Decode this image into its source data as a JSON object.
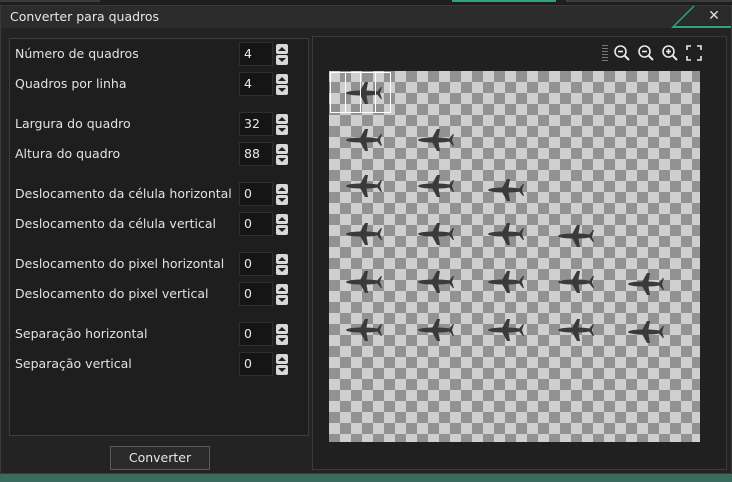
{
  "window": {
    "title": "Converter para quadros"
  },
  "fields": [
    {
      "label": "Número de quadros",
      "value": "4"
    },
    {
      "label": "Quadros por linha",
      "value": "4"
    },
    {
      "label": "Largura do quadro",
      "value": "32"
    },
    {
      "label": "Altura do quadro",
      "value": "88"
    },
    {
      "label": "Deslocamento da célula horizontal",
      "value": "0"
    },
    {
      "label": "Deslocamento da célula vertical",
      "value": "0"
    },
    {
      "label": "Deslocamento do pixel horizontal",
      "value": "0"
    },
    {
      "label": "Deslocamento do pixel vertical",
      "value": "0"
    },
    {
      "label": "Separação horizontal",
      "value": "0"
    },
    {
      "label": "Separação vertical",
      "value": "0"
    }
  ],
  "actions": {
    "convert_label": "Converter"
  },
  "toolbar": {
    "icons": [
      "zoom-out-icon",
      "zoom-out-alt-icon",
      "zoom-in-icon",
      "fullscreen-icon"
    ]
  },
  "colors": {
    "accent": "#2fa37e",
    "panel": "#1e1e1e",
    "checker_dark": "#929292",
    "checker_light": "#cfcfcf"
  }
}
